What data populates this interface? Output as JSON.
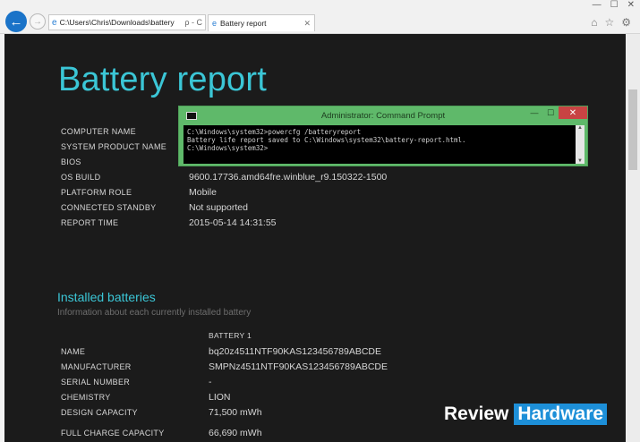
{
  "browser": {
    "address": "C:\\Users\\Chris\\Downloads\\battery",
    "address_tools": "ρ - C",
    "tab_title": "Battery report",
    "window_controls": [
      "—",
      "☐",
      "✕"
    ]
  },
  "report": {
    "title": "Battery report",
    "info": [
      {
        "label": "COMPUTER NAME",
        "value": ""
      },
      {
        "label": "SYSTEM PRODUCT NAME",
        "value": ""
      },
      {
        "label": "BIOS",
        "value": ""
      },
      {
        "label": "OS BUILD",
        "value": "9600.17736.amd64fre.winblue_r9.150322-1500"
      },
      {
        "label": "PLATFORM ROLE",
        "value": "Mobile"
      },
      {
        "label": "CONNECTED STANDBY",
        "value": "Not supported"
      },
      {
        "label": "REPORT TIME",
        "value": "2015-05-14  14:31:55"
      }
    ],
    "installed": {
      "title": "Installed batteries",
      "subtitle": "Information about each currently installed battery",
      "column": "BATTERY 1",
      "rows": [
        {
          "label": "NAME",
          "value": "bq20z4511NTF90KAS123456789ABCDE"
        },
        {
          "label": "MANUFACTURER",
          "value": "SMPNz4511NTF90KAS123456789ABCDE"
        },
        {
          "label": "SERIAL NUMBER",
          "value": "-"
        },
        {
          "label": "CHEMISTRY",
          "value": "LION"
        },
        {
          "label": "DESIGN CAPACITY",
          "value": "71,500 mWh"
        },
        {
          "label": "FULL CHARGE CAPACITY",
          "value": "66,690 mWh"
        }
      ]
    }
  },
  "cmd": {
    "title": "Administrator: Command Prompt",
    "lines": [
      "C:\\Windows\\system32>powercfg /batteryreport",
      "Battery life report saved to C:\\Windows\\system32\\battery-report.html.",
      "",
      "C:\\Windows\\system32>"
    ],
    "buttons": [
      "—",
      "☐",
      "✕"
    ]
  },
  "watermark": {
    "review": "Review",
    "hardware": "Hardware"
  }
}
